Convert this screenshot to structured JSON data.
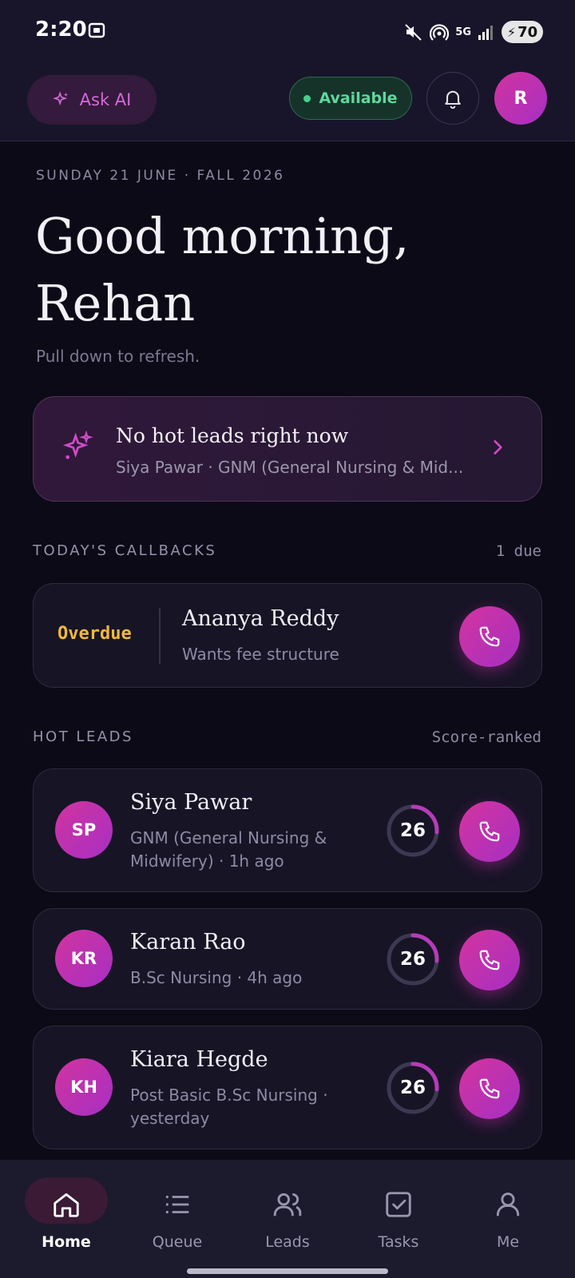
{
  "status_bar": {
    "time": "2:20",
    "network": "5G",
    "battery": "70"
  },
  "header": {
    "ask_ai_label": "Ask AI",
    "availability_label": "Available",
    "avatar_initial": "R"
  },
  "greeting": {
    "date_line": "SUNDAY 21 JUNE · FALL 2026",
    "line1": "Good morning,",
    "line2": "Rehan",
    "refresh_hint": "Pull down to refresh."
  },
  "hot_banner": {
    "title": "No hot leads right now",
    "subtitle": "Siya Pawar · GNM (General Nursing & Mid..."
  },
  "callbacks": {
    "section_label": "TODAY'S CALLBACKS",
    "due_label": "1 due",
    "items": [
      {
        "status": "Overdue",
        "name": "Ananya Reddy",
        "note": "Wants fee structure"
      }
    ]
  },
  "hot_leads": {
    "section_label": "HOT LEADS",
    "sort_label": "Score-ranked",
    "items": [
      {
        "initials": "SP",
        "name": "Siya Pawar",
        "detail_line1": "GNM (General Nursing &",
        "detail_line2": "Midwifery) · 1h ago",
        "score": "26",
        "score_value": 26
      },
      {
        "initials": "KR",
        "name": "Karan Rao",
        "detail_line1": "B.Sc Nursing · 4h ago",
        "detail_line2": "",
        "score": "26",
        "score_value": 26
      },
      {
        "initials": "KH",
        "name": "Kiara Hegde",
        "detail_line1": "Post Basic B.Sc Nursing ·",
        "detail_line2": "yesterday",
        "score": "26",
        "score_value": 26
      }
    ]
  },
  "bottom_nav": {
    "items": [
      {
        "label": "Home",
        "icon": "home-icon",
        "active": true
      },
      {
        "label": "Queue",
        "icon": "list-icon",
        "active": false
      },
      {
        "label": "Leads",
        "icon": "users-icon",
        "active": false
      },
      {
        "label": "Tasks",
        "icon": "checkbox-icon",
        "active": false
      },
      {
        "label": "Me",
        "icon": "user-icon",
        "active": false
      }
    ]
  },
  "colors": {
    "accent": "#c832aa",
    "background": "#0c0a16",
    "available_green": "#5fd89b",
    "overdue_amber": "#f0b93a"
  }
}
